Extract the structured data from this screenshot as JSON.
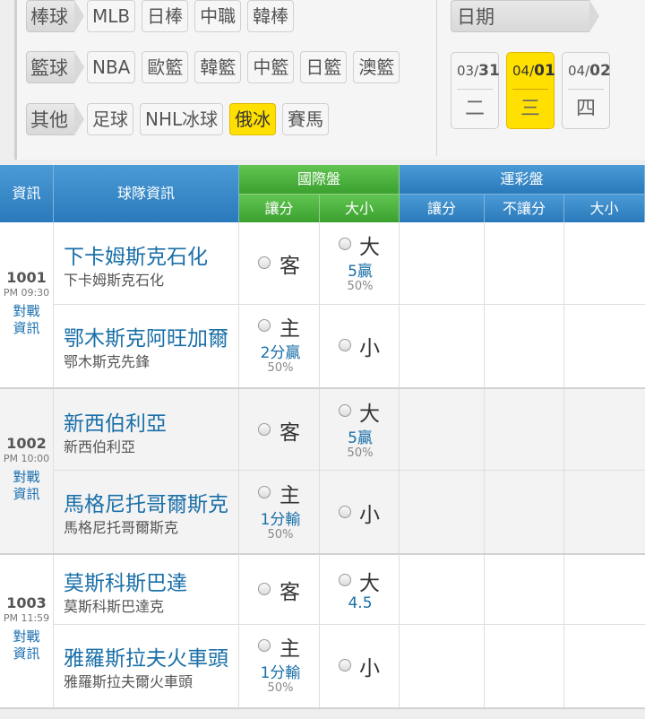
{
  "filters": {
    "baseball": {
      "label": "棒球",
      "chips": [
        "MLB",
        "日棒",
        "中職",
        "韓棒"
      ]
    },
    "basketball": {
      "label": "籃球",
      "chips": [
        "NBA",
        "歐籃",
        "韓籃",
        "中籃",
        "日籃",
        "澳籃"
      ]
    },
    "other": {
      "label": "其他",
      "chips": [
        "足球",
        "NHL冰球",
        "俄冰",
        "賽馬"
      ],
      "active": "俄冰"
    }
  },
  "date_picker": {
    "label": "日期",
    "dates": [
      {
        "month": "03/",
        "day": "31",
        "weekday": "二"
      },
      {
        "month": "04/",
        "day": "01",
        "weekday": "三",
        "active": true
      },
      {
        "month": "04/",
        "day": "02",
        "weekday": "四"
      }
    ]
  },
  "table": {
    "headers": {
      "info": "資訊",
      "team_info": "球隊資訊",
      "intl": "國際盤",
      "intl_spread": "讓分",
      "intl_total": "大小",
      "lottery": "運彩盤",
      "lot_spread": "讓分",
      "lot_nospread": "不讓分",
      "lot_total": "大小"
    },
    "games": [
      {
        "id": "1001",
        "time": "PM 09:30",
        "link1": "對戰",
        "link2": "資訊",
        "away": {
          "name": "下卡姆斯克石化",
          "sub": "下卡姆斯克石化",
          "spread": "客",
          "total": "大",
          "total_odds": "5贏",
          "total_pct": "50%"
        },
        "home": {
          "name": "鄂木斯克阿旺加爾",
          "sub": "鄂木斯克先鋒",
          "spread": "主",
          "spread_odds": "2分贏",
          "spread_pct": "50%",
          "total": "小"
        }
      },
      {
        "id": "1002",
        "time": "PM 10:00",
        "link1": "對戰",
        "link2": "資訊",
        "away": {
          "name": "新西伯利亞",
          "sub": "新西伯利亞",
          "spread": "客",
          "total": "大",
          "total_odds": "5贏",
          "total_pct": "50%"
        },
        "home": {
          "name": "馬格尼托哥爾斯克",
          "sub": "馬格尼托哥爾斯克",
          "spread": "主",
          "spread_odds": "1分輸",
          "spread_pct": "50%",
          "total": "小"
        }
      },
      {
        "id": "1003",
        "time": "PM 11:59",
        "link1": "對戰",
        "link2": "資訊",
        "away": {
          "name": "莫斯科斯巴達",
          "sub": "莫斯科斯巴達克",
          "spread": "客",
          "total": "大",
          "total_odds": "4.5"
        },
        "home": {
          "name": "雅羅斯拉夫火車頭",
          "sub": "雅羅斯拉夫爾火車頭",
          "spread": "主",
          "spread_odds": "1分輸",
          "spread_pct": "50%",
          "total": "小"
        }
      }
    ]
  }
}
